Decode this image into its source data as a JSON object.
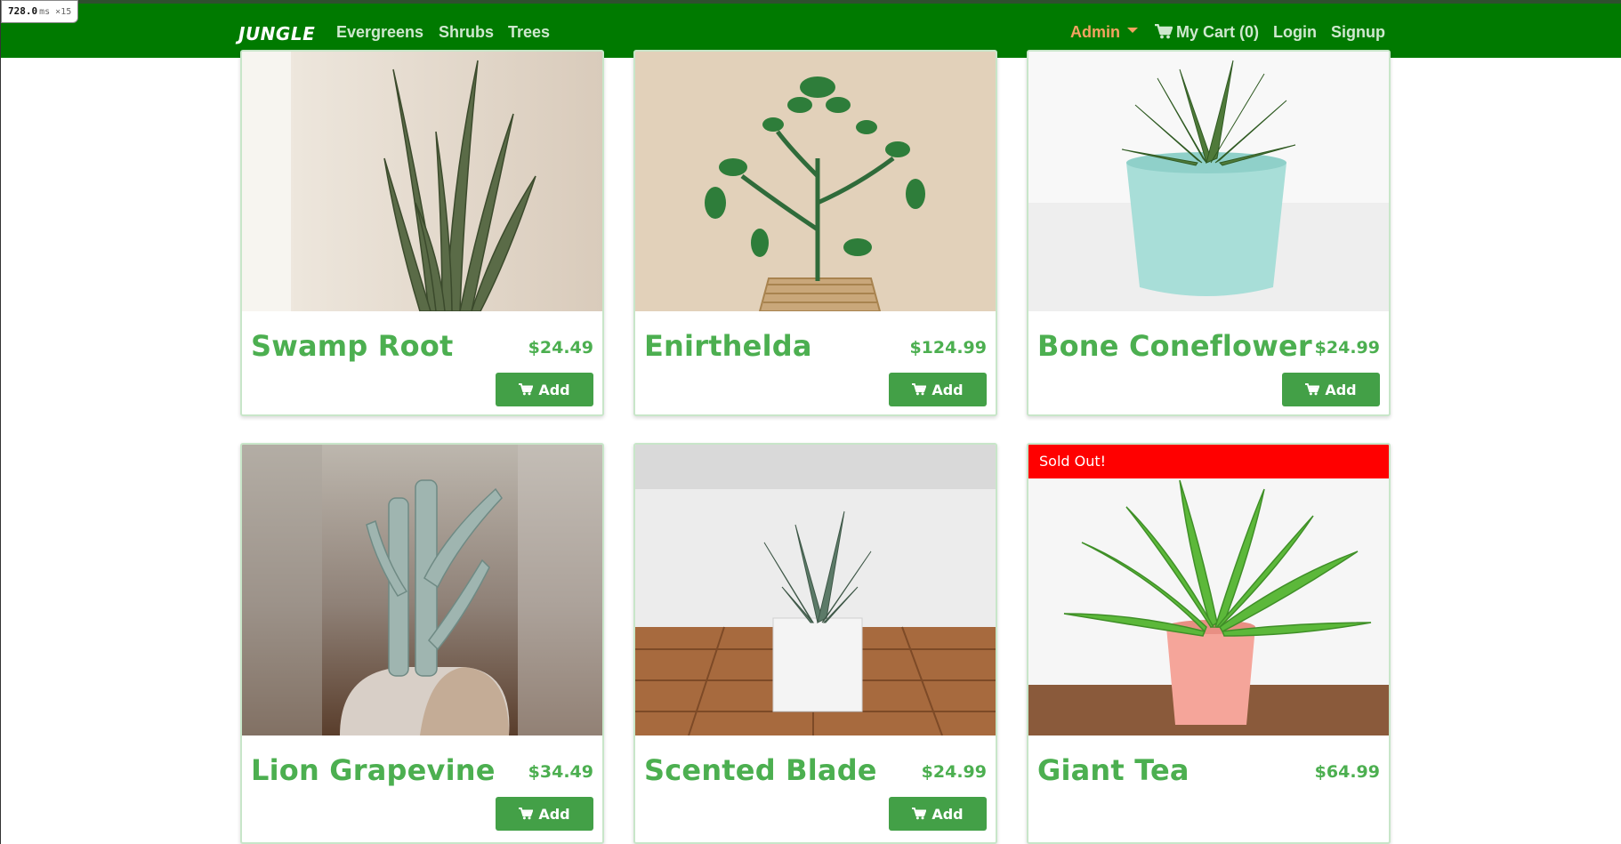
{
  "perf": {
    "value": "728.0",
    "unit": "ms",
    "mult": "×15"
  },
  "nav": {
    "brand": "JUNGLE",
    "links": [
      "Evergreens",
      "Shrubs",
      "Trees"
    ],
    "admin": "Admin",
    "cart": "My Cart (0)",
    "login": "Login",
    "signup": "Signup"
  },
  "products": [
    {
      "name": "Swamp Root",
      "price": "$24.49",
      "button": "Add",
      "image": "snake-plant"
    },
    {
      "name": "Enirthelda",
      "price": "$124.99",
      "button": "Add",
      "image": "jade-plant"
    },
    {
      "name": "Bone Coneflower",
      "price": "$24.99",
      "button": "Add",
      "image": "haworthia-teal-pot"
    },
    {
      "name": "Lion Grapevine",
      "price": "$34.49",
      "button": "Add",
      "image": "euphorbia-cactus"
    },
    {
      "name": "Scented Blade",
      "price": "$24.99",
      "button": "Add",
      "image": "succulent-white-pot"
    },
    {
      "name": "Giant Tea",
      "price": "$64.99",
      "sold_out": "Sold Out!",
      "image": "birds-nest-fern"
    }
  ],
  "colors": {
    "navbar": "#007a00",
    "accent": "#4caf50",
    "button": "#43a047",
    "sold_out": "#ff0000"
  }
}
